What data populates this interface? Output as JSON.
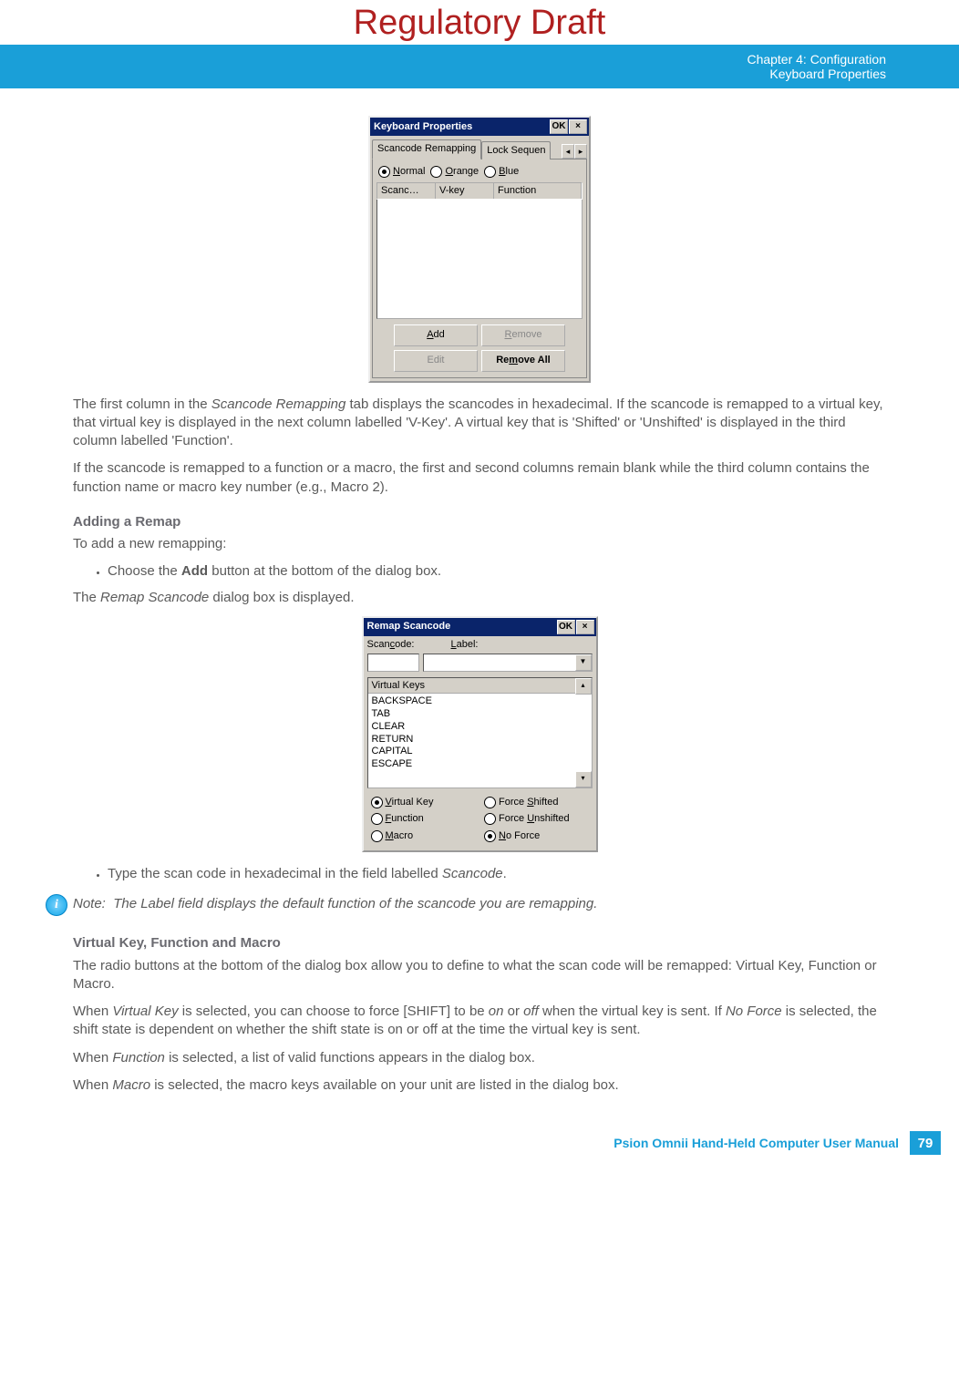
{
  "draft_banner": "Regulatory Draft",
  "header": {
    "chapter": "Chapter 4:  Configuration",
    "section": "Keyboard Properties"
  },
  "dialog1": {
    "title": "Keyboard Properties",
    "ok": "OK",
    "close": "×",
    "tab_active": "Scancode Remapping",
    "tab_other": "Lock Sequen",
    "radio_normal": "Normal",
    "radio_orange": "Orange",
    "radio_blue": "Blue",
    "col_scanc": "Scanc…",
    "col_vkey": "V-key",
    "col_func": "Function",
    "btn_add": "Add",
    "btn_remove": "Remove",
    "btn_edit": "Edit",
    "btn_remove_all": "Remove All"
  },
  "para1": "The first column in the Scancode Remapping tab displays the scancodes in hexadecimal. If the scancode is remapped to a virtual key, that virtual key is displayed in the next column labelled 'V-Key'. A virtual key that is 'Shifted' or 'Unshifted' is displayed in the third column labelled 'Function'.",
  "para2": "If the scancode is remapped to a function or a macro, the first and second columns remain blank while the third column contains the function name or macro key number (e.g., Macro 2).",
  "heading_add": "Adding a Remap",
  "add_intro": "To add a new remapping:",
  "add_bullet": "Choose the Add button at the bottom of the dialog box.",
  "add_after": "The Remap Scancode dialog box is displayed.",
  "dialog2": {
    "title": "Remap Scancode",
    "ok": "OK",
    "close": "×",
    "lbl_scancode": "Scancode:",
    "lbl_label": "Label:",
    "list_header": "Virtual Keys",
    "items": [
      "BACKSPACE",
      "TAB",
      "CLEAR",
      "RETURN",
      "CAPITAL",
      "ESCAPE"
    ],
    "r_virtual": "Virtual Key",
    "r_function": "Function",
    "r_macro": "Macro",
    "r_fshift": "Force Shifted",
    "r_funshift": "Force Unshifted",
    "r_noforce": "No Force"
  },
  "type_bullet": "Type the scan code in hexadecimal in the field labelled Scancode.",
  "note_label": "Note:",
  "note_text": "The Label field displays the default function of the scancode you are remapping.",
  "heading_vfm": "Virtual Key, Function and Macro",
  "vfm_p1": "The radio buttons at the bottom of the dialog box allow you to define to what the scan code will be remapped: Virtual Key, Function or Macro.",
  "vfm_p2": "When Virtual Key is selected, you can choose to force [SHIFT] to be on or off when the virtual key is sent. If No Force is selected, the shift state is dependent on whether the shift state is on or off at the time the virtual key is sent.",
  "vfm_p3": "When Function is selected, a list of valid functions appears in the dialog box.",
  "vfm_p4": "When Macro is selected, the macro keys available on your unit are listed in the dialog box.",
  "footer_text": "Psion Omnii Hand-Held Computer User Manual",
  "page_number": "79"
}
